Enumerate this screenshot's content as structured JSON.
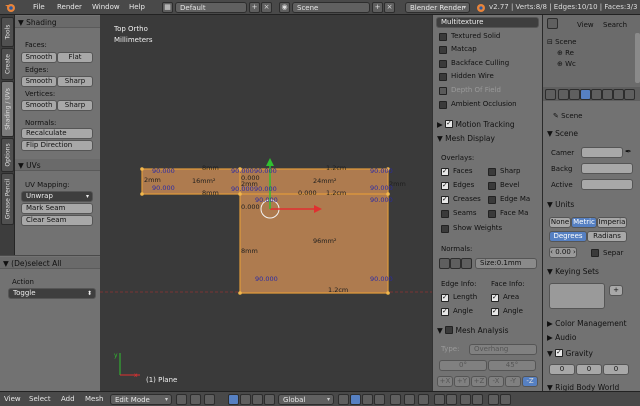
{
  "topbar": {
    "menus": [
      "File",
      "Render",
      "Window",
      "Help"
    ],
    "layout": "Default",
    "scene": "Scene",
    "engine": "Blender Render",
    "stats": "v2.77 | Verts:8/8 | Edges:10/10 | Faces:3/3"
  },
  "vtabs": [
    "Tools",
    "Create",
    "Shading / UVs",
    "Options",
    "Grease Pencil"
  ],
  "shading": {
    "title": "Shading",
    "faces_label": "Faces:",
    "smooth": "Smooth",
    "flat": "Flat",
    "edges_label": "Edges:",
    "edges_smooth": "Smooth",
    "edges_sharp": "Sharp",
    "vertices_label": "Vertices:",
    "verts_smooth": "Smooth",
    "verts_sharp": "Sharp",
    "normals_label": "Normals:",
    "recalculate": "Recalculate",
    "flip": "Flip Direction"
  },
  "uvs": {
    "title": "UVs",
    "mapping_label": "UV Mapping:",
    "unwrap": "Unwrap",
    "mark_seam": "Mark Seam",
    "clear_seam": "Clear Seam"
  },
  "operator": {
    "title": "(De)select All",
    "action_label": "Action",
    "action_value": "Toggle"
  },
  "viewport": {
    "view_name": "Top Ortho",
    "units": "Millimeters",
    "object_label": "(1) Plane",
    "labels": {
      "top_edge": "8mm",
      "top_edge_len": "1.2cm",
      "left_edge": "2mm",
      "area_small": "16mm²",
      "mid_2mm": "2mm",
      "mid_8mm": "8mm",
      "area_mid": "24mm²",
      "edge_right": "2mm",
      "mid_12cm": "1.2cm",
      "area_big": "96mm²",
      "big_left": "8mm",
      "bottom_len": "1.2cm",
      "ang1": "90.000",
      "ang2": "90.000",
      "ang3": "90.000",
      "ang4": "90.000",
      "ang5": "90.000",
      "ang6": "90.000",
      "ang7": "90.000",
      "ang8": "90.000",
      "ang9": "90.000",
      "ang10": "90.000",
      "ang11": "90.000",
      "ang12": "90.000",
      "zero1": "0.000",
      "zero2": "0.000",
      "zero3": "0.000"
    }
  },
  "props": {
    "shading_mode": "Multitexture",
    "options": [
      "Textured Solid",
      "Matcap",
      "Backface Culling",
      "Hidden Wire",
      "Depth Of Field",
      "Ambient Occlusion"
    ],
    "motion_tracking": "Motion Tracking",
    "mesh_display": "Mesh Display",
    "overlays_label": "Overlays:",
    "overlays_left": [
      "Faces",
      "Edges",
      "Creases",
      "Seams",
      "Show Weights"
    ],
    "overlays_right": [
      "Sharp",
      "Bevel",
      "Edge Ma",
      "Face Ma"
    ],
    "normals_label": "Normals:",
    "size_field": "Size:0.1mm",
    "edge_info": "Edge Info:",
    "face_info": "Face Info:",
    "length": "Length",
    "area": "Area",
    "angle": "Angle",
    "angle2": "Angle",
    "mesh_analysis": "Mesh Analysis",
    "type_label": "Type:",
    "type_value": "Overhang",
    "angle_min": "0°",
    "angle_max": "45°",
    "axes": [
      "+X",
      "+Y",
      "+Z",
      "-X",
      "-Y",
      "-Z"
    ]
  },
  "outliner": {
    "view": "View",
    "search": "Search",
    "all_scenes": "All Scenes",
    "scene": "Scene",
    "item1": "Re",
    "item2": "Wc"
  },
  "properties": {
    "scene_name": "Scene",
    "scene_panel": "Scene",
    "camera_label": "Camer",
    "backg_label": "Backg",
    "active_label": "Active",
    "units_panel": "Units",
    "unit_none": "None",
    "unit_metric": "Metric",
    "unit_imperial": "Imperia",
    "degrees": "Degrees",
    "radians": "Radians",
    "scale_value": "0.00",
    "separate": "Separ",
    "keying_sets": "Keying Sets",
    "color_management": "Color Management",
    "audio": "Audio",
    "gravity": "Gravity",
    "gravity_value": "0",
    "rigid_body": "Rigid Body World"
  },
  "bottombar": {
    "menus": [
      "View",
      "Select",
      "Add",
      "Mesh"
    ],
    "mode": "Edit Mode",
    "orientation": "Global"
  }
}
